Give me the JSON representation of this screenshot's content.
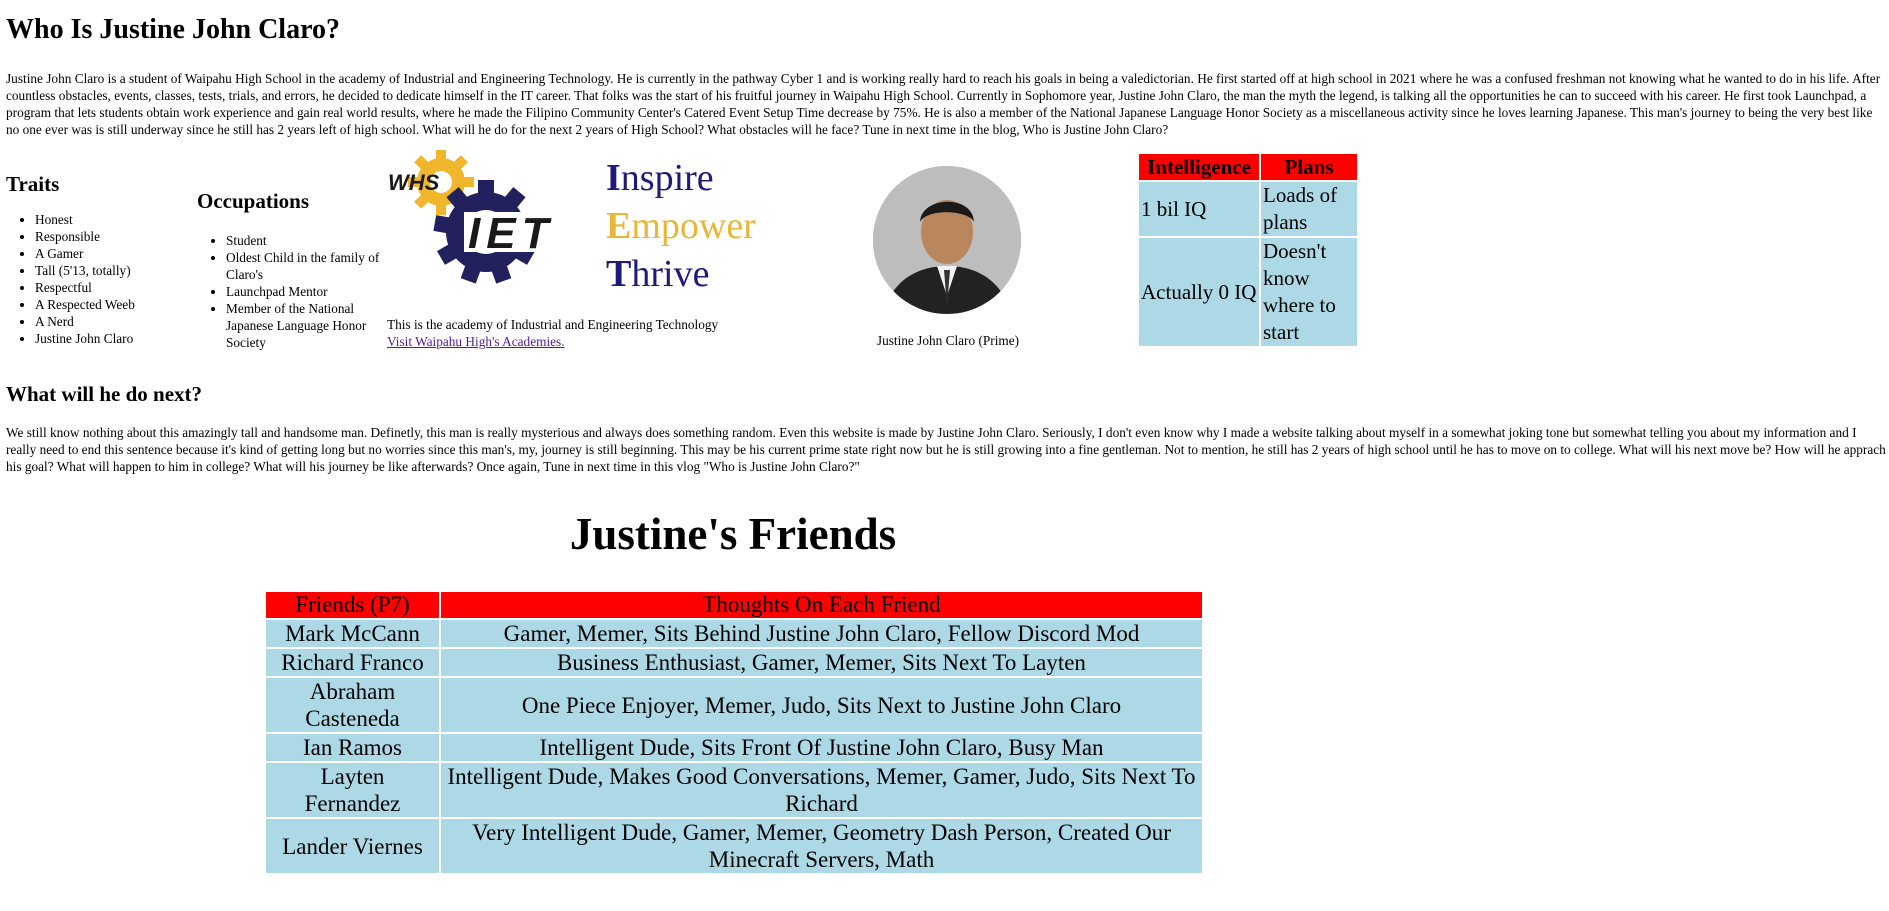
{
  "page": {
    "title": "Who Is Justine John Claro?",
    "intro": "Justine John Claro is a student of Waipahu High School in the academy of Industrial and Engineering Technology. He is currently in the pathway Cyber 1 and is working really hard to reach his goals in being a valedictorian. He first started off at high school in 2021 where he was a confused freshman not knowing what he wanted to do in his life. After countless obstacles, events, classes, tests, trials, and errors, he decided to dedicate himself in the IT career. That folks was the start of his fruitful journey in Waipahu High School. Currently in Sophomore year, Justine John Claro, the man the myth the legend, is talking all the opportunities he can to succeed with his career. He first took Launchpad, a program that lets students obtain work experience and gain real world results, where he made the Filipino Community Center's Catered Event Setup Time decrease by 75%. He is also a member of the National Japanese Language Honor Society as a miscellaneous activity since he loves learning Japanese. This man's journey to being the very best like no one ever was is still underway since he still has 2 years left of high school. What will he do for the next 2 years of High School? What obstacles will he face? Tune in next time in the blog, Who is Justine John Claro?"
  },
  "traits": {
    "heading": "Traits",
    "items": [
      "Honest",
      "Responsible",
      "A Gamer",
      "Tall (5'13, totally)",
      "Respectful",
      "A Respected Weeb",
      "A Nerd",
      "Justine John Claro"
    ]
  },
  "occupations": {
    "heading": "Occupations",
    "items": [
      "Student",
      "Oldest Child in the family of Claro's",
      "Launchpad Mentor",
      "Member of the National Japanese Language Honor Society"
    ]
  },
  "academy": {
    "logo_text_whs": "WHS",
    "logo_text_iet": "IET",
    "tagline": {
      "w1_first": "I",
      "w1_rest": "nspire",
      "w2_first": "E",
      "w2_rest": "mpower",
      "w3_first": "T",
      "w3_rest": "hrive"
    },
    "caption": "This is the academy of Industrial and Engineering Technology",
    "link": "Visit Waipahu High's Academies."
  },
  "photo": {
    "caption": "Justine John Claro (Prime)"
  },
  "stats_table": {
    "headers": [
      "Intelligence",
      "Plans"
    ],
    "rows": [
      [
        "1 bil IQ",
        "Loads of plans"
      ],
      [
        "Actually 0 IQ",
        "Doesn't know where to start"
      ]
    ]
  },
  "next": {
    "heading": "What will he do next?",
    "text": "We still know nothing about this amazingly tall and handsome man. Definetly, this man is really mysterious and always does something random. Even this website is made by Justine John Claro. Seriously, I don't even know why I made a website talking about myself in a somewhat joking tone but somewhat telling you about my information and I really need to end this sentence because it's kind of getting long but no worries since this man's, my, journey is still beginning. This may be his current prime state right now but he is still growing into a fine gentleman. Not to mention, he still has 2 years of high school until he has to move on to college. What will his next move be? How will he apprach his goal? What will happen to him in college? What will his journey be like afterwards? Once again, Tune in next time in this vlog \"Who is Justine John Claro?\""
  },
  "friends": {
    "heading": "Justine's Friends",
    "headers": [
      "Friends (P7)",
      "Thoughts On Each Friend"
    ],
    "rows": [
      [
        "Mark McCann",
        "Gamer, Memer, Sits Behind Justine John Claro, Fellow Discord Mod"
      ],
      [
        "Richard Franco",
        "Business Enthusiast, Gamer, Memer, Sits Next To Layten"
      ],
      [
        "Abraham Casteneda",
        "One Piece Enjoyer, Memer, Judo, Sits Next to Justine John Claro"
      ],
      [
        "Ian Ramos",
        "Intelligent Dude, Sits Front Of Justine John Claro, Busy Man"
      ],
      [
        "Layten Fernandez",
        "Intelligent Dude, Makes Good Conversations, Memer, Gamer, Judo, Sits Next To Richard"
      ],
      [
        "Lander Viernes",
        "Very Intelligent Dude, Gamer, Memer, Geometry Dash Person, Created Our Minecraft Servers, Math"
      ]
    ]
  },
  "colors": {
    "header_red": "#ff0000",
    "cell_blue": "#add8e6",
    "logo_navy": "#1e1a7a",
    "logo_gold": "#e8b73a",
    "link_visited": "#551a8b"
  }
}
